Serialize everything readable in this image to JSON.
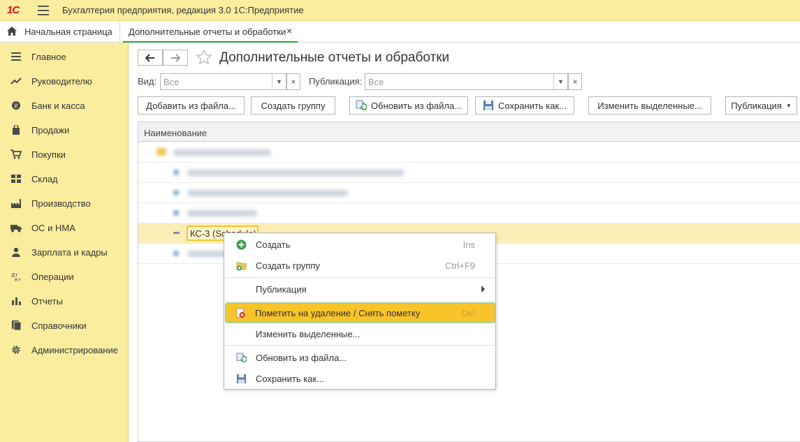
{
  "app": {
    "title": "Бухгалтерия предприятия, редакция 3.0 1С:Предприятие",
    "logo": "1С"
  },
  "tabs": {
    "home_label": "Начальная страница",
    "doc_label": "Дополнительные отчеты и обработки",
    "close": "×"
  },
  "sidebar": {
    "items": [
      {
        "label": "Главное",
        "icon": "menu-icon"
      },
      {
        "label": "Руководителю",
        "icon": "trend-icon"
      },
      {
        "label": "Банк и касса",
        "icon": "coin-icon"
      },
      {
        "label": "Продажи",
        "icon": "bag-icon"
      },
      {
        "label": "Покупки",
        "icon": "cart-icon"
      },
      {
        "label": "Склад",
        "icon": "warehouse-icon"
      },
      {
        "label": "Производство",
        "icon": "factory-icon"
      },
      {
        "label": "ОС и НМА",
        "icon": "truck-icon"
      },
      {
        "label": "Зарплата и кадры",
        "icon": "person-icon"
      },
      {
        "label": "Операции",
        "icon": "dt-kt-icon"
      },
      {
        "label": "Отчеты",
        "icon": "bar-chart-icon"
      },
      {
        "label": "Справочники",
        "icon": "book-icon"
      },
      {
        "label": "Администрирование",
        "icon": "gear-icon"
      }
    ]
  },
  "page": {
    "title": "Дополнительные отчеты и обработки"
  },
  "filters": {
    "view_label": "Вид:",
    "view_value": "Все",
    "pub_label": "Публикация:",
    "pub_value": "Все"
  },
  "toolbar": {
    "add_from_file": "Добавить из файла...",
    "create_group": "Создать группу",
    "update_from_file": "Обновить из файла...",
    "save_as": "Сохранить как...",
    "change_selected": "Изменить выделенные...",
    "publication": "Публикация"
  },
  "grid": {
    "column": "Наименование",
    "selected_value": "КС-3 (Schedule)"
  },
  "context_menu": {
    "create": "Создать",
    "create_key": "Ins",
    "create_group": "Создать группу",
    "create_group_key": "Ctrl+F9",
    "publication": "Публикация",
    "mark_delete": "Пометить на удаление / Снять пометку",
    "mark_delete_key": "Del",
    "change_selected": "Изменить выделенные...",
    "update_from_file": "Обновить из файла...",
    "save_as": "Сохранить как..."
  },
  "colors": {
    "accent_yellow": "#fbed9e",
    "menu_highlight": "#f8c42a",
    "tab_underline": "#2f9d3e",
    "logo_red": "#d4131b"
  }
}
